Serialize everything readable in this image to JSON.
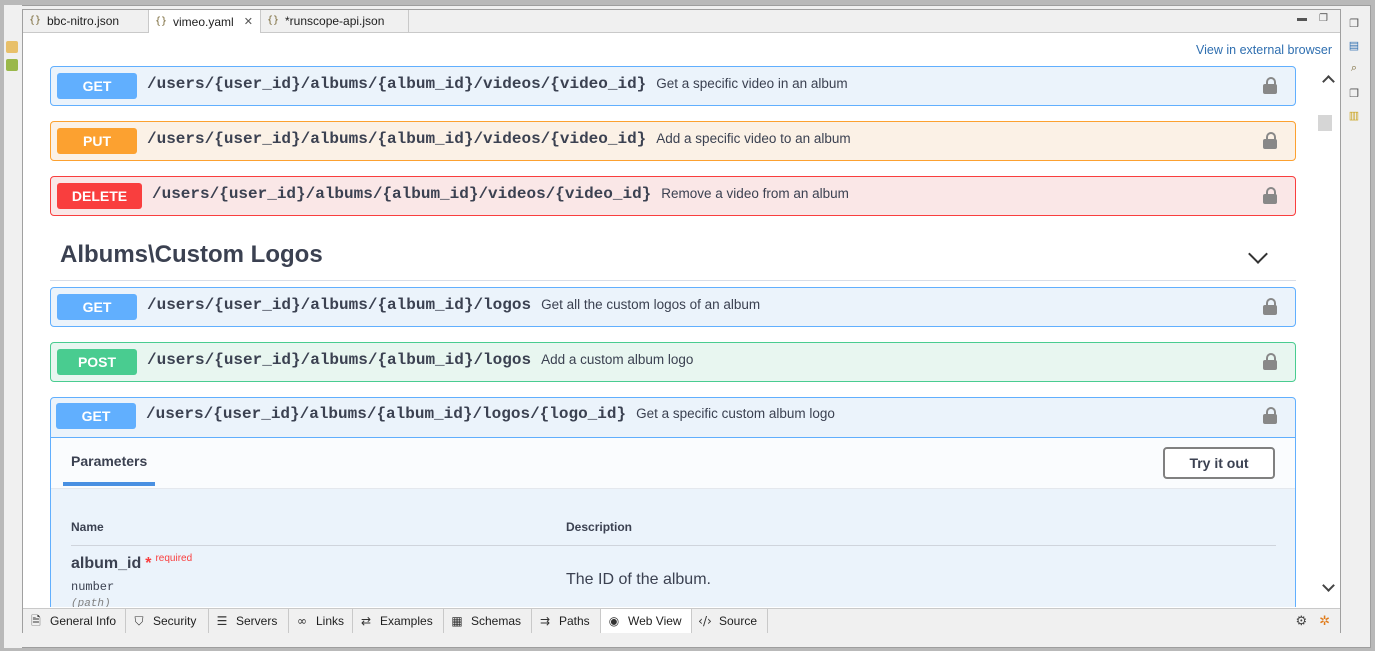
{
  "tabs": [
    {
      "label": "bbc-nitro.json",
      "active": false
    },
    {
      "label": "vimeo.yaml",
      "active": true,
      "closable": true
    },
    {
      "label": "*runscope-api.json",
      "active": false
    }
  ],
  "header": {
    "external_link": "View in external browser"
  },
  "operations_top": [
    {
      "method": "GET",
      "path": "/users/{user_id}/albums/{album_id}/videos/{video_id}",
      "summary": "Get a specific video in an album"
    },
    {
      "method": "PUT",
      "path": "/users/{user_id}/albums/{album_id}/videos/{video_id}",
      "summary": "Add a specific video to an album"
    },
    {
      "method": "DELETE",
      "path": "/users/{user_id}/albums/{album_id}/videos/{video_id}",
      "summary": "Remove a video from an album"
    }
  ],
  "section": {
    "title": "Albums\\Custom Logos"
  },
  "operations_section": [
    {
      "method": "GET",
      "path": "/users/{user_id}/albums/{album_id}/logos",
      "summary": "Get all the custom logos of an album"
    },
    {
      "method": "POST",
      "path": "/users/{user_id}/albums/{album_id}/logos",
      "summary": "Add a custom album logo"
    },
    {
      "method": "GET",
      "path": "/users/{user_id}/albums/{album_id}/logos/{logo_id}",
      "summary": "Get a specific custom album logo"
    }
  ],
  "expanded": {
    "params_tab": "Parameters",
    "try_button": "Try it out",
    "col_name": "Name",
    "col_desc": "Description",
    "param": {
      "name": "album_id",
      "star": "*",
      "required": "required",
      "type": "number",
      "in": "(path)",
      "description": "The ID of the album."
    }
  },
  "bottom_tabs": [
    {
      "label": "General Info",
      "icon": "document-icon"
    },
    {
      "label": "Security",
      "icon": "shield-icon"
    },
    {
      "label": "Servers",
      "icon": "server-icon"
    },
    {
      "label": "Links",
      "icon": "link-icon"
    },
    {
      "label": "Examples",
      "icon": "examples-icon"
    },
    {
      "label": "Schemas",
      "icon": "schemas-icon"
    },
    {
      "label": "Paths",
      "icon": "paths-icon"
    },
    {
      "label": "Web View",
      "icon": "web-icon",
      "active": true
    },
    {
      "label": "Source",
      "icon": "code-icon"
    }
  ],
  "colors": {
    "get": "#61affe",
    "put": "#fca130",
    "delete": "#f93e3e",
    "post": "#49cc90",
    "link": "#2f6fb0"
  }
}
